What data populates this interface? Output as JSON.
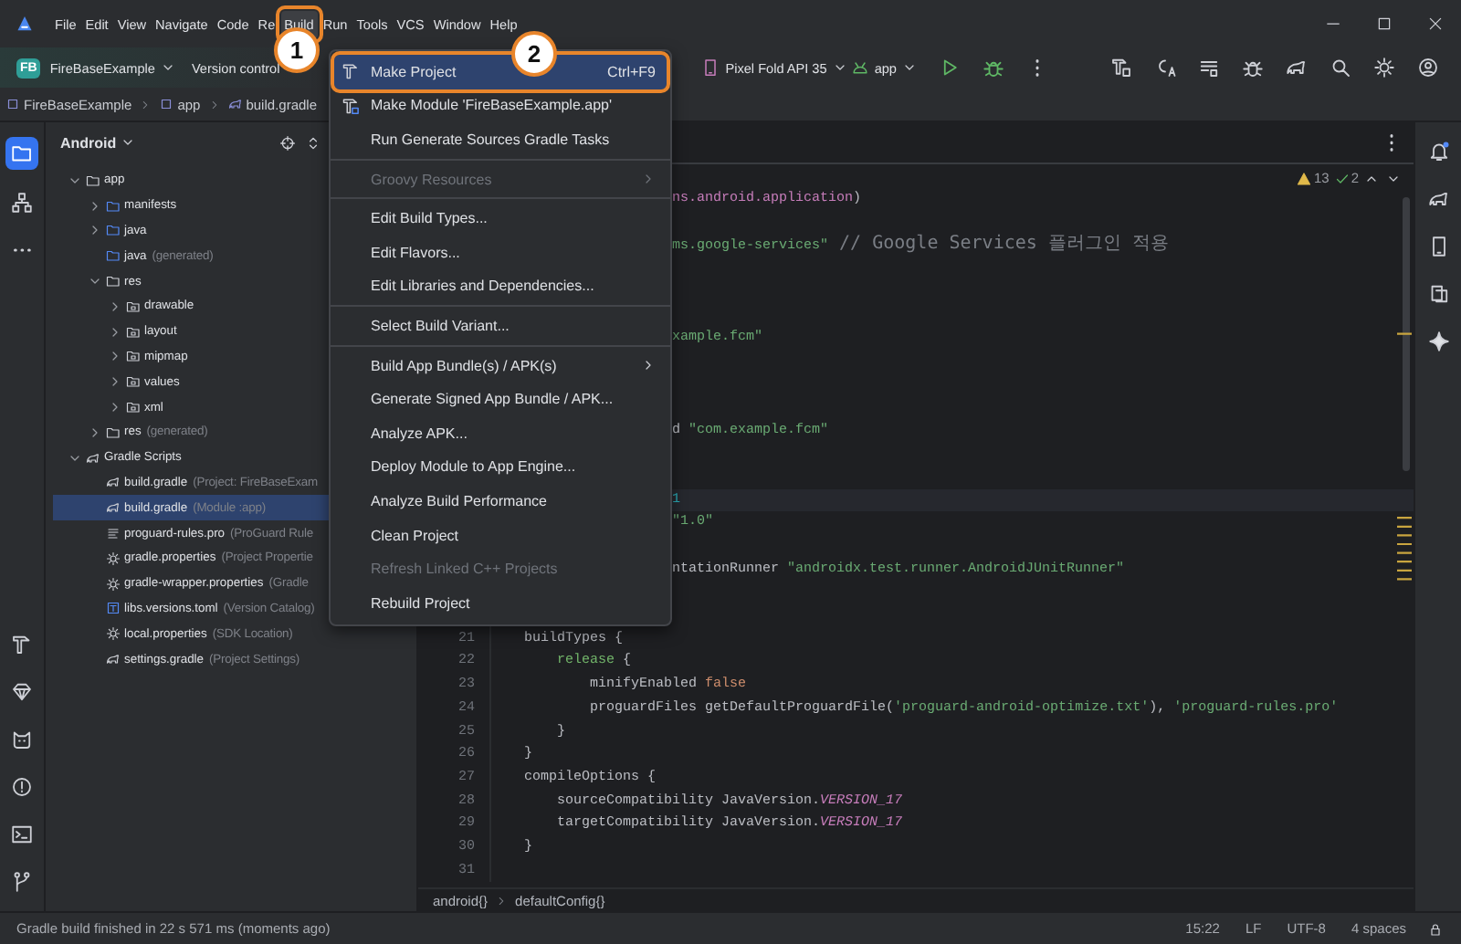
{
  "menu_bar": {
    "items": [
      {
        "label": "File",
        "selected": false
      },
      {
        "label": "Edit",
        "selected": false
      },
      {
        "label": "View",
        "selected": false
      },
      {
        "label": "Navigate",
        "selected": false
      },
      {
        "label": "Code",
        "selected": false
      },
      {
        "label": "Re",
        "selected": false
      },
      {
        "label": "Build",
        "selected": true
      },
      {
        "label": "Run",
        "selected": false
      },
      {
        "label": "Tools",
        "selected": false
      },
      {
        "label": "VCS",
        "selected": false
      },
      {
        "label": "Window",
        "selected": false
      },
      {
        "label": "Help",
        "selected": false
      }
    ]
  },
  "toolbar": {
    "project_badge": "FB",
    "project": "FireBaseExample",
    "version_control": "Version control",
    "device": "Pixel Fold API 35",
    "run_config": "app"
  },
  "navigation_bar": [
    {
      "label": "FireBaseExample",
      "kind": "module"
    },
    {
      "label": "app",
      "kind": "module"
    },
    {
      "label": "build.gradle",
      "kind": "gradle"
    }
  ],
  "project": {
    "view": "Android",
    "tree": [
      {
        "label": "app",
        "kind": "module",
        "expanded": true,
        "selected": false,
        "children": [
          {
            "label": "manifests",
            "kind": "folder",
            "expanded": false,
            "selected": false
          },
          {
            "label": "java",
            "kind": "folder",
            "expanded": false,
            "selected": false
          },
          {
            "label": "java",
            "hint": "(generated)",
            "kind": "generated",
            "selected": false
          },
          {
            "label": "res",
            "kind": "resources",
            "expanded": true,
            "selected": false,
            "children": [
              {
                "label": "drawable",
                "kind": "package",
                "expanded": false,
                "selected": false
              },
              {
                "label": "layout",
                "kind": "package",
                "expanded": false,
                "selected": false
              },
              {
                "label": "mipmap",
                "kind": "package",
                "expanded": false,
                "selected": false
              },
              {
                "label": "values",
                "kind": "package",
                "expanded": false,
                "selected": false
              },
              {
                "label": "xml",
                "kind": "package",
                "expanded": false,
                "selected": false
              }
            ]
          },
          {
            "label": "res",
            "hint": "(generated)",
            "kind": "resources",
            "expanded": false,
            "selected": false
          }
        ]
      },
      {
        "label": "Gradle Scripts",
        "kind": "gradle",
        "expanded": true,
        "selected": false,
        "children": [
          {
            "label": "build.gradle",
            "hint": "(Project: FireBaseExam",
            "kind": "gradle",
            "selected": false
          },
          {
            "label": "build.gradle",
            "hint": "(Module :app)",
            "kind": "gradle",
            "selected": true
          },
          {
            "label": "proguard-rules.pro",
            "hint": "(ProGuard Rule",
            "kind": "text",
            "selected": false
          },
          {
            "label": "gradle.properties",
            "hint": "(Project Propertie",
            "kind": "settings",
            "selected": false
          },
          {
            "label": "gradle-wrapper.properties",
            "hint": "(Gradle",
            "kind": "settings",
            "selected": false
          },
          {
            "label": "libs.versions.toml",
            "hint": "(Version Catalog)",
            "kind": "toml",
            "selected": false
          },
          {
            "label": "local.properties",
            "hint": "(SDK Location)",
            "kind": "settings",
            "selected": false
          },
          {
            "label": "settings.gradle",
            "hint": "(Project Settings)",
            "kind": "gradle",
            "selected": false
          }
        ]
      }
    ]
  },
  "build_menu": {
    "items": [
      {
        "kind": "hammer",
        "label": "Make Project",
        "shortcut": "Ctrl+F9",
        "selected": true,
        "disabled": false,
        "submenu": false
      },
      {
        "kind": "module",
        "label": "Make Module 'FireBaseExample.app'",
        "selected": false,
        "disabled": false,
        "submenu": false
      },
      {
        "kind": "plain",
        "label": "Run Generate Sources Gradle Tasks",
        "selected": false,
        "disabled": false,
        "submenu": false
      },
      {
        "kind": "separator"
      },
      {
        "kind": "plain",
        "label": "Groovy Resources",
        "selected": false,
        "disabled": true,
        "submenu": true
      },
      {
        "kind": "separator"
      },
      {
        "kind": "plain",
        "label": "Edit Build Types...",
        "selected": false,
        "disabled": false,
        "submenu": false
      },
      {
        "kind": "plain",
        "label": "Edit Flavors...",
        "selected": false,
        "disabled": false,
        "submenu": false
      },
      {
        "kind": "plain",
        "label": "Edit Libraries and Dependencies...",
        "selected": false,
        "disabled": false,
        "submenu": false
      },
      {
        "kind": "separator"
      },
      {
        "kind": "plain",
        "label": "Select Build Variant...",
        "selected": false,
        "disabled": false,
        "submenu": false
      },
      {
        "kind": "separator"
      },
      {
        "kind": "plain",
        "label": "Build App Bundle(s) / APK(s)",
        "selected": false,
        "disabled": false,
        "submenu": true
      },
      {
        "kind": "plain",
        "label": "Generate Signed App Bundle / APK...",
        "selected": false,
        "disabled": false,
        "submenu": false
      },
      {
        "kind": "plain",
        "label": "Analyze APK...",
        "selected": false,
        "disabled": false,
        "submenu": false
      },
      {
        "kind": "plain",
        "label": "Deploy Module to App Engine...",
        "selected": false,
        "disabled": false,
        "submenu": false
      },
      {
        "kind": "plain",
        "label": "Analyze Build Performance",
        "selected": false,
        "disabled": false,
        "submenu": false
      },
      {
        "kind": "plain",
        "label": "Clean Project",
        "selected": false,
        "disabled": false,
        "submenu": false
      },
      {
        "kind": "plain",
        "label": "Refresh Linked C++ Projects",
        "selected": false,
        "disabled": true,
        "submenu": false
      },
      {
        "kind": "plain",
        "label": "Rebuild Project",
        "selected": false,
        "disabled": false,
        "submenu": false
      }
    ]
  },
  "annotations": [
    {
      "label": "1"
    },
    {
      "label": "2"
    }
  ],
  "editor": {
    "warnings": "13",
    "checks": "2",
    "lines": [
      {
        "kind": "blank",
        "current": false
      },
      {
        "kind": "partial",
        "current": false,
        "tokens": [
          {
            "text": "ns.android.application",
            "kind": "property"
          },
          {
            "text": ")",
            "kind": "plain"
          }
        ]
      },
      {
        "kind": "blank",
        "current": false
      },
      {
        "kind": "partial",
        "current": false,
        "tokens": [
          {
            "text": "ms.google-services\"",
            "kind": "string"
          },
          {
            "text": " // Google Services 플러그인 적용",
            "kind": "comment"
          }
        ]
      },
      {
        "kind": "blank",
        "current": false
      },
      {
        "kind": "blank",
        "current": false
      },
      {
        "kind": "blank",
        "current": false
      },
      {
        "kind": "partial",
        "current": false,
        "tokens": [
          {
            "text": "xample.fcm\"",
            "kind": "string"
          }
        ]
      },
      {
        "kind": "blank",
        "current": false
      },
      {
        "kind": "blank",
        "current": false
      },
      {
        "kind": "blank",
        "current": false
      },
      {
        "kind": "partial",
        "current": false,
        "tokens": [
          {
            "text": "d ",
            "kind": "plain"
          },
          {
            "text": "\"com.example.fcm\"",
            "kind": "string"
          }
        ]
      },
      {
        "kind": "blank",
        "current": false
      },
      {
        "kind": "blank",
        "current": false
      },
      {
        "kind": "partial",
        "current": true,
        "tokens": [
          {
            "text": "1",
            "kind": "number"
          }
        ]
      },
      {
        "kind": "partial",
        "current": false,
        "tokens": [
          {
            "text": "\"1.0\"",
            "kind": "string"
          }
        ]
      },
      {
        "kind": "blank",
        "current": false
      },
      {
        "kind": "partial",
        "current": false,
        "tokens": [
          {
            "text": "ntationRunner ",
            "kind": "plain"
          },
          {
            "text": "\"androidx.test.runner.AndroidJUnitRunner\"",
            "kind": "string"
          }
        ]
      },
      {
        "kind": "blank",
        "current": false
      },
      {
        "kind": "blank",
        "current": false
      },
      {
        "kind": "full",
        "number": "21",
        "current": false,
        "tokens": [
          {
            "text": "    buildTypes {",
            "kind": "plain"
          }
        ]
      },
      {
        "kind": "full",
        "number": "22",
        "current": false,
        "tokens": [
          {
            "text": "        release",
            "kind": "call"
          },
          {
            "text": " {",
            "kind": "plain"
          }
        ]
      },
      {
        "kind": "full",
        "number": "23",
        "current": false,
        "tokens": [
          {
            "text": "            minifyEnabled ",
            "kind": "plain"
          },
          {
            "text": "false",
            "kind": "keyword"
          }
        ]
      },
      {
        "kind": "full",
        "number": "24",
        "current": false,
        "tokens": [
          {
            "text": "            proguardFiles getDefaultProguardFile(",
            "kind": "plain"
          },
          {
            "text": "'proguard-android-optimize.txt'",
            "kind": "string"
          },
          {
            "text": "), ",
            "kind": "plain"
          },
          {
            "text": "'proguard-rules.pro'",
            "kind": "string"
          }
        ]
      },
      {
        "kind": "full",
        "number": "25",
        "current": false,
        "tokens": [
          {
            "text": "        }",
            "kind": "plain"
          }
        ]
      },
      {
        "kind": "full",
        "number": "26",
        "current": false,
        "tokens": [
          {
            "text": "    }",
            "kind": "plain"
          }
        ]
      },
      {
        "kind": "full",
        "number": "27",
        "current": false,
        "tokens": [
          {
            "text": "    compileOptions {",
            "kind": "plain"
          }
        ]
      },
      {
        "kind": "full",
        "number": "28",
        "current": false,
        "tokens": [
          {
            "text": "        sourceCompatibility JavaVersion.",
            "kind": "plain"
          },
          {
            "text": "VERSION_17",
            "kind": "constant"
          }
        ]
      },
      {
        "kind": "full",
        "number": "29",
        "current": false,
        "tokens": [
          {
            "text": "        targetCompatibility JavaVersion.",
            "kind": "plain"
          },
          {
            "text": "VERSION_17",
            "kind": "constant"
          }
        ]
      },
      {
        "kind": "full",
        "number": "30",
        "current": false,
        "tokens": [
          {
            "text": "    }",
            "kind": "plain"
          }
        ]
      },
      {
        "kind": "full",
        "number": "31",
        "current": false
      }
    ],
    "breadcrumbs": [
      "android{}",
      "defaultConfig{}"
    ]
  },
  "status_bar": {
    "message": "Gradle build finished in 22 s 571 ms (moments ago)",
    "caret": "15:22",
    "line_separator": "LF",
    "encoding": "UTF-8",
    "indent": "4 spaces"
  }
}
